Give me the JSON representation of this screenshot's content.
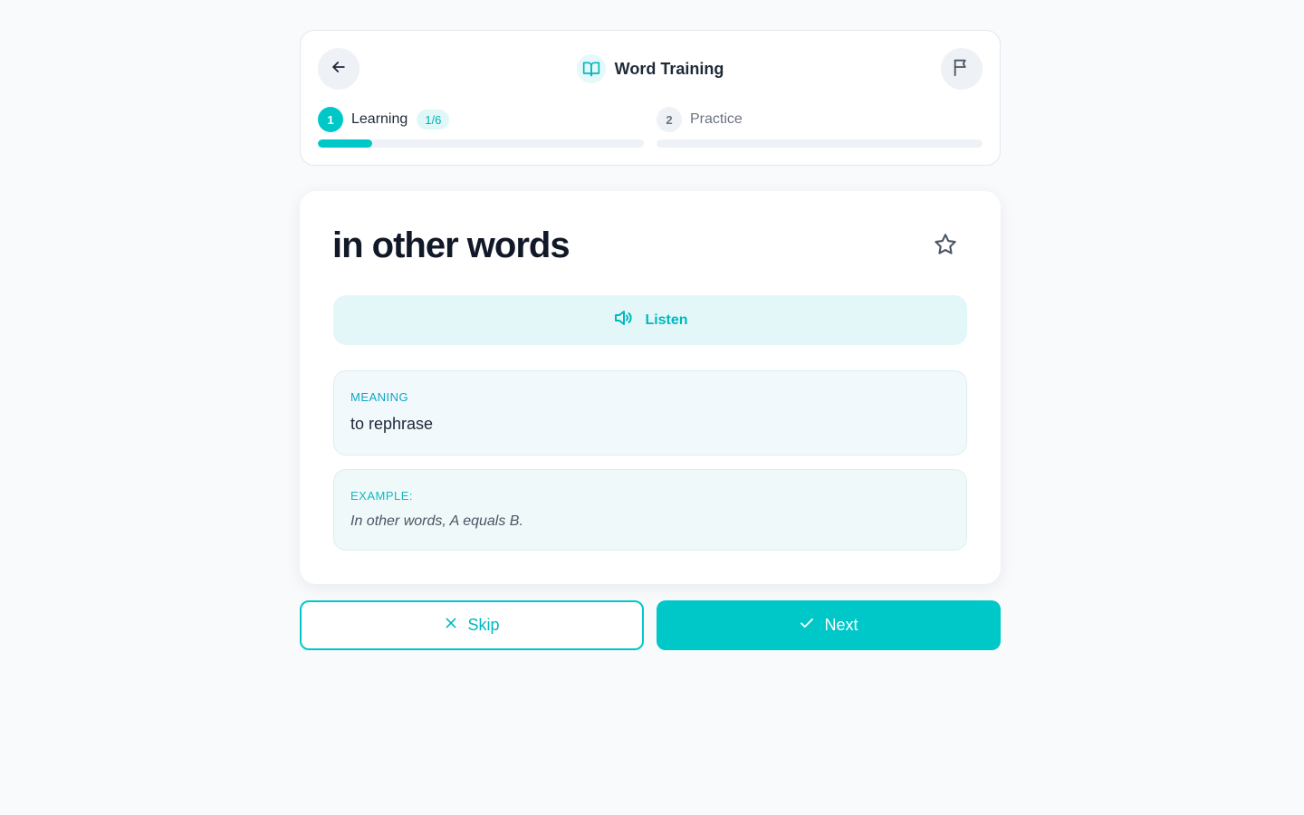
{
  "header": {
    "title": "Word Training",
    "steps": [
      {
        "number": "1",
        "label": "Learning",
        "badge": "1/6",
        "progress": 0.167,
        "active": true
      },
      {
        "number": "2",
        "label": "Practice",
        "badge": "",
        "progress": 0,
        "active": false
      }
    ]
  },
  "card": {
    "word": "in other words",
    "listen_label": "Listen",
    "meaning_label": "MEANING",
    "meaning_text": "to rephrase",
    "example_label": "EXAMPLE:",
    "example_text": "In other words, A equals B."
  },
  "actions": {
    "skip_label": "Skip",
    "next_label": "Next"
  },
  "icons": {
    "back": "arrow-left-icon",
    "title": "book-open-icon",
    "flag": "flag-icon",
    "star": "star-icon",
    "listen": "speaker-icon",
    "skip": "x-icon",
    "next": "check-icon"
  },
  "colors": {
    "accent": "#00c8c8",
    "background": "#f8fafc"
  }
}
